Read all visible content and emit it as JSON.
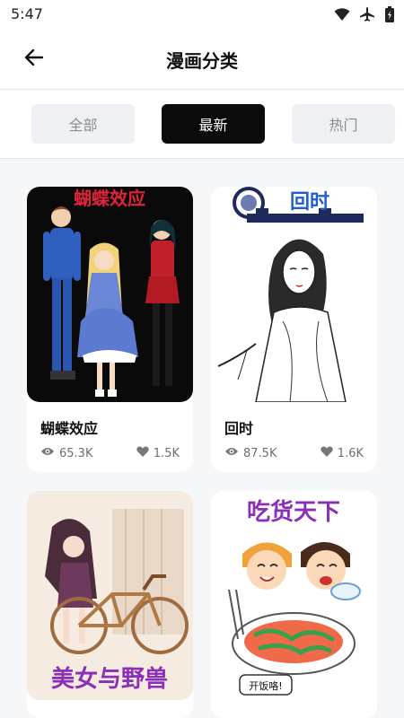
{
  "status_bar": {
    "time": "5:47",
    "icons": [
      "wifi-icon",
      "airplane-icon",
      "battery-icon"
    ]
  },
  "header": {
    "title": "漫画分类",
    "back_icon": "back-arrow-icon"
  },
  "tabs": [
    {
      "label": "全部",
      "active": false
    },
    {
      "label": "最新",
      "active": true
    },
    {
      "label": "热门",
      "active": false
    }
  ],
  "colors": {
    "active_tab_bg": "#0b0b0b",
    "inactive_tab_bg": "#eef0f3",
    "page_bg": "#f6f7f9",
    "cover_red_title": "#e0243a",
    "cover_purple_title": "#8c2fb8"
  },
  "comics": [
    {
      "title": "蝴蝶效应",
      "cover_text": "蝴蝶效应",
      "views": "65.3K",
      "likes": "1.5K"
    },
    {
      "title": "回时",
      "cover_text": "回时",
      "views": "87.5K",
      "likes": "1.6K"
    },
    {
      "title": "",
      "cover_text": "美女与野兽",
      "views": "",
      "likes": ""
    },
    {
      "title": "",
      "cover_text": "吃货天下",
      "cover_caption": "开饭咯!",
      "views": "",
      "likes": ""
    }
  ],
  "stat_icons": {
    "views": "eye-icon",
    "likes": "heart-icon"
  }
}
